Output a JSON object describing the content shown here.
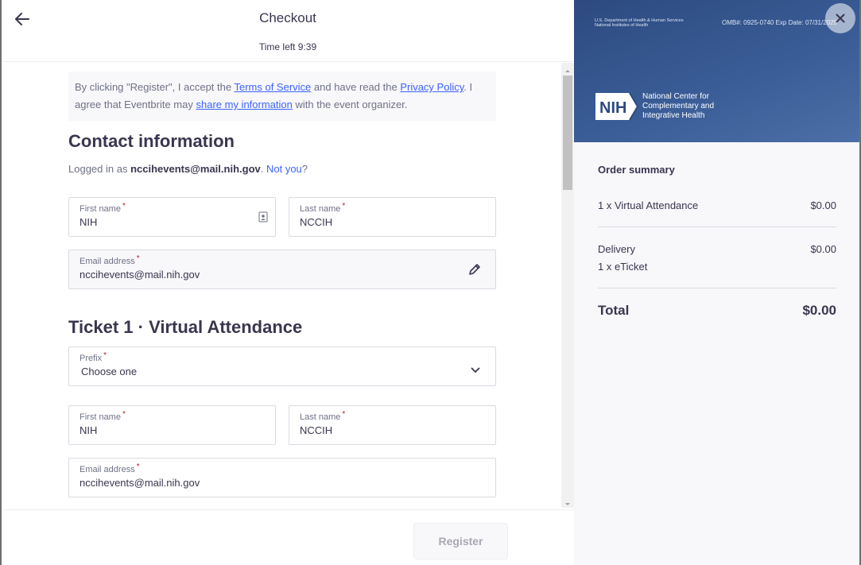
{
  "header": {
    "title": "Checkout",
    "time_left": "Time left 9:39"
  },
  "legal": {
    "text1": "By clicking \"Register\", I accept the ",
    "terms_link": "Terms of Service",
    "text2": " and have read the ",
    "privacy_link": "Privacy Policy",
    "text3": ". I agree that Eventbrite may ",
    "share_link": "share my information",
    "text4": " with the event organizer."
  },
  "contact": {
    "title": "Contact information",
    "logged_in_prefix": "Logged in as ",
    "email_bold": "nccihevents@mail.nih.gov",
    "period": ". ",
    "not_you": "Not you",
    "qmark": "?",
    "first_name_label": "First name",
    "first_name_value": "NIH",
    "last_name_label": "Last name",
    "last_name_value": "NCCIH",
    "email_label": "Email address",
    "email_value": "nccihevents@mail.nih.gov"
  },
  "ticket": {
    "title": "Ticket 1 · Virtual Attendance",
    "prefix_label": "Prefix",
    "prefix_value": "Choose one",
    "first_name_label": "First name",
    "first_name_value": "NIH",
    "last_name_label": "Last name",
    "last_name_value": "NCCIH",
    "email_label": "Email address",
    "email_value": "nccihevents@mail.nih.gov"
  },
  "required_marker": "*",
  "footer": {
    "register_label": "Register"
  },
  "banner": {
    "hhs_line1": "U.S. Department of Health & Human Services",
    "hhs_line2": "National Institutes of Health",
    "omb": "OMB#: 0925-0740 Exp Date: 07/31/2025",
    "nih_logo_text": "NIH",
    "org_line1": "National Center for",
    "org_line2": "Complementary and",
    "org_line3": "Integrative Health"
  },
  "summary": {
    "title": "Order summary",
    "item_label": "1 x Virtual Attendance",
    "item_price": "$0.00",
    "delivery_label": "Delivery",
    "delivery_price": "$0.00",
    "delivery_detail": "1 x eTicket",
    "total_label": "Total",
    "total_price": "$0.00"
  },
  "icons": {
    "back": "arrow-left-icon",
    "contact_card": "contact-card-icon",
    "edit": "pencil-icon",
    "dropdown": "chevron-down-icon",
    "close": "close-icon"
  },
  "colors": {
    "link": "#3d64ff",
    "text": "#39364f",
    "muted": "#6f7287",
    "required": "#c5162e",
    "banner": "#3a5c96"
  }
}
